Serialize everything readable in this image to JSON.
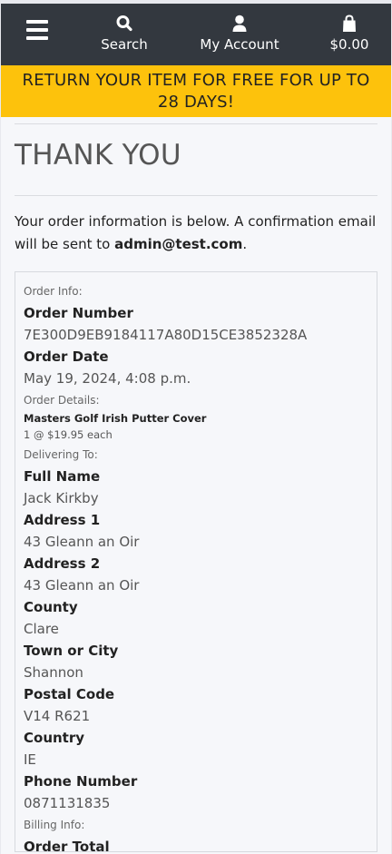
{
  "nav": {
    "search_label": "Search",
    "account_label": "My Account",
    "bag_total": "$0.00"
  },
  "banner": {
    "line1": "RETURN YOUR ITEM FOR FREE FOR UP TO",
    "line2": "28 DAYS!"
  },
  "page": {
    "title": "THANK YOU",
    "intro_text": "Your order information is below. A confirmation email will be sent to ",
    "email": "admin@test.com",
    "intro_end": "."
  },
  "order": {
    "order_info_heading": "Order Info:",
    "order_number_label": "Order Number",
    "order_number": "7E300D9EB9184117A80D15CE3852328A",
    "order_date_label": "Order Date",
    "order_date": "May 19, 2024, 4:08 p.m.",
    "order_details_heading": "Order Details:",
    "item_name": "Masters Golf Irish Putter Cover",
    "item_qty": "1 @ $19.95 each",
    "delivering_heading": "Delivering To:",
    "full_name_label": "Full Name",
    "full_name": "Jack Kirkby",
    "address1_label": "Address 1",
    "address1": "43 Gleann an Oir",
    "address2_label": "Address 2",
    "address2": "43 Gleann an Oir",
    "county_label": "County",
    "county": "Clare",
    "town_label": "Town or City",
    "town": "Shannon",
    "postal_label": "Postal Code",
    "postal": "V14 R621",
    "country_label": "Country",
    "country": "IE",
    "phone_label": "Phone Number",
    "phone": "0871131835",
    "billing_heading": "Billing Info:",
    "order_total_label": "Order Total"
  },
  "icons": {
    "menu": "hamburger-icon",
    "search": "search-icon",
    "account": "user-icon",
    "bag": "shopping-bag-icon"
  },
  "colors": {
    "topbar": "#33383f",
    "banner": "#fdc20c",
    "background": "#f6f7fa"
  }
}
